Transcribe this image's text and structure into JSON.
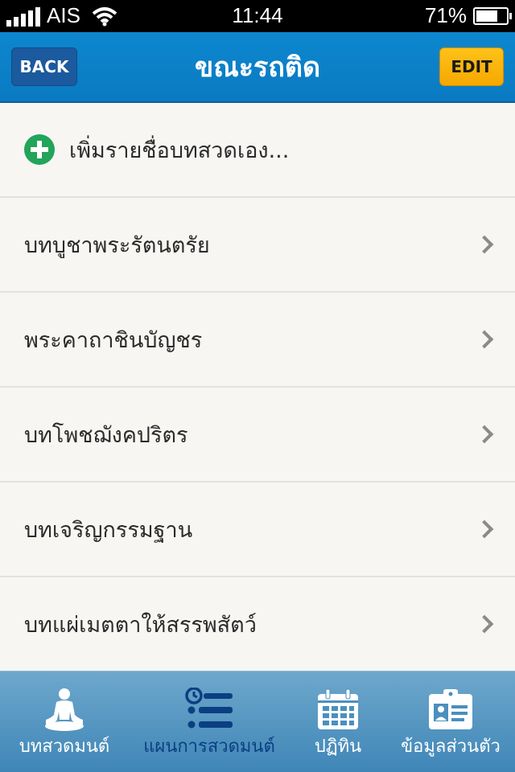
{
  "status_bar": {
    "carrier": "AIS",
    "time": "11:44",
    "battery_percent": "71%",
    "battery_level": 0.71
  },
  "nav": {
    "title": "ขณะรถติด",
    "back_label": "BACK",
    "edit_label": "EDIT"
  },
  "add_item": {
    "label": "เพิ่มรายชื่อบทสวดเอง..."
  },
  "list": {
    "items": [
      {
        "label": "บทบูชาพระรัตนตรัย"
      },
      {
        "label": "พระคาถาชินบัญชร"
      },
      {
        "label": "บทโพชฌังคปริตร"
      },
      {
        "label": "บทเจริญกรรมฐาน"
      },
      {
        "label": "บทแผ่เมตตาให้สรรพสัตว์"
      }
    ]
  },
  "tabs": [
    {
      "label": "บทสวดมนต์",
      "icon": "meditation-icon",
      "active": false
    },
    {
      "label": "แผนการสวดมนต์",
      "icon": "schedule-list-icon",
      "active": true
    },
    {
      "label": "ปฏิทิน",
      "icon": "calendar-icon",
      "active": false
    },
    {
      "label": "ข้อมูลส่วนตัว",
      "icon": "id-card-icon",
      "active": false
    }
  ],
  "colors": {
    "nav_blue": "#0d87cf",
    "back_button": "#1b5a9e",
    "edit_button": "#ffc21a",
    "add_icon_green": "#22a45a",
    "tab_active": "#0b3f82"
  }
}
